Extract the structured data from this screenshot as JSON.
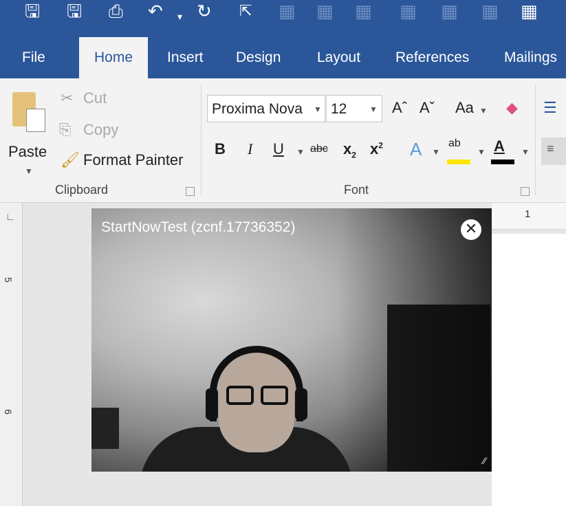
{
  "qat": {
    "icons": [
      "save-icon",
      "save-as-icon",
      "print-preview-icon",
      "undo-icon",
      "redo-icon",
      "select-icon",
      "table-icon"
    ]
  },
  "tabs": [
    "File",
    "Home",
    "Insert",
    "Design",
    "Layout",
    "References",
    "Mailings"
  ],
  "clipboard": {
    "paste": "Paste",
    "cut": "Cut",
    "copy": "Copy",
    "format_painter": "Format Painter",
    "group_label": "Clipboard"
  },
  "font": {
    "font_name": "Proxima Nova",
    "font_size": "12",
    "change_case": "Aa",
    "bold": "B",
    "italic": "I",
    "underline": "U",
    "strikethrough": "abc",
    "subscript": "x",
    "subscript_mark": "2",
    "superscript": "x",
    "superscript_mark": "2",
    "text_effects": "A",
    "highlight": "ab",
    "font_color": "A",
    "group_label": "Font"
  },
  "ruler": {
    "h_mark": "1",
    "v_mark_5": "5",
    "v_mark_6": "6"
  },
  "video": {
    "title": "StartNowTest (zcnf.17736352)",
    "close": "✕"
  },
  "colors": {
    "accent": "#2b579a",
    "highlight": "#ffe600",
    "font_color": "#000000"
  }
}
